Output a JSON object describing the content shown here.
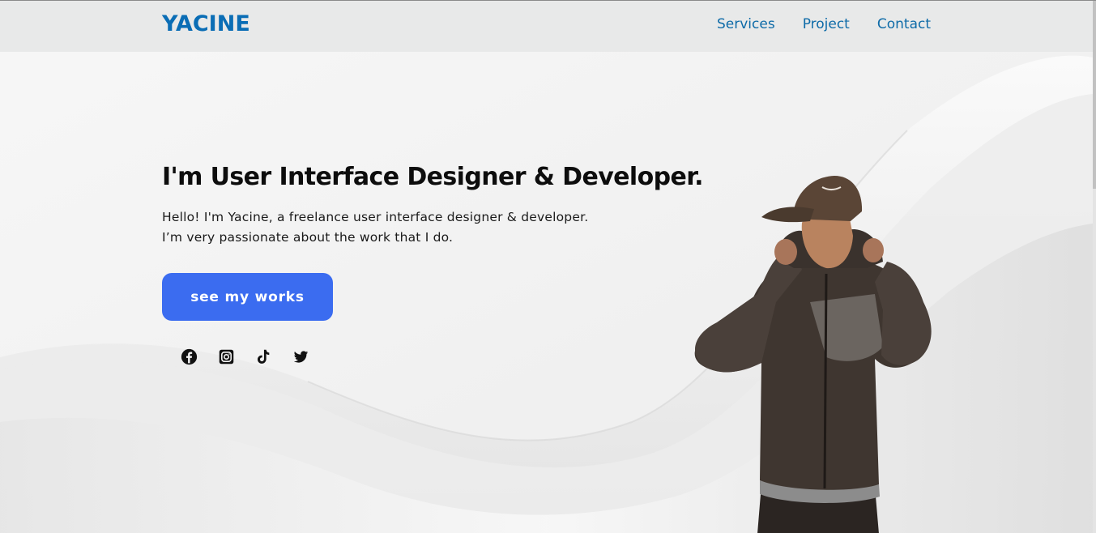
{
  "navbar": {
    "logo": "YACINE",
    "links": [
      "Services",
      "Project",
      "Contact"
    ]
  },
  "hero": {
    "title": "I'm User Interface Designer & Developer.",
    "description_line1": "Hello! I'm Yacine, a freelance user interface designer & developer.",
    "description_line2": "I’m very passionate about the work that I do.",
    "cta_label": "see my works"
  },
  "social": [
    "facebook-icon",
    "instagram-icon",
    "tiktok-icon",
    "twitter-icon"
  ],
  "colors": {
    "brand": "#0a6db5",
    "nav_link": "#0e6ba8",
    "cta": "#3b6cf0",
    "navbar_bg": "#e8e9e9"
  }
}
